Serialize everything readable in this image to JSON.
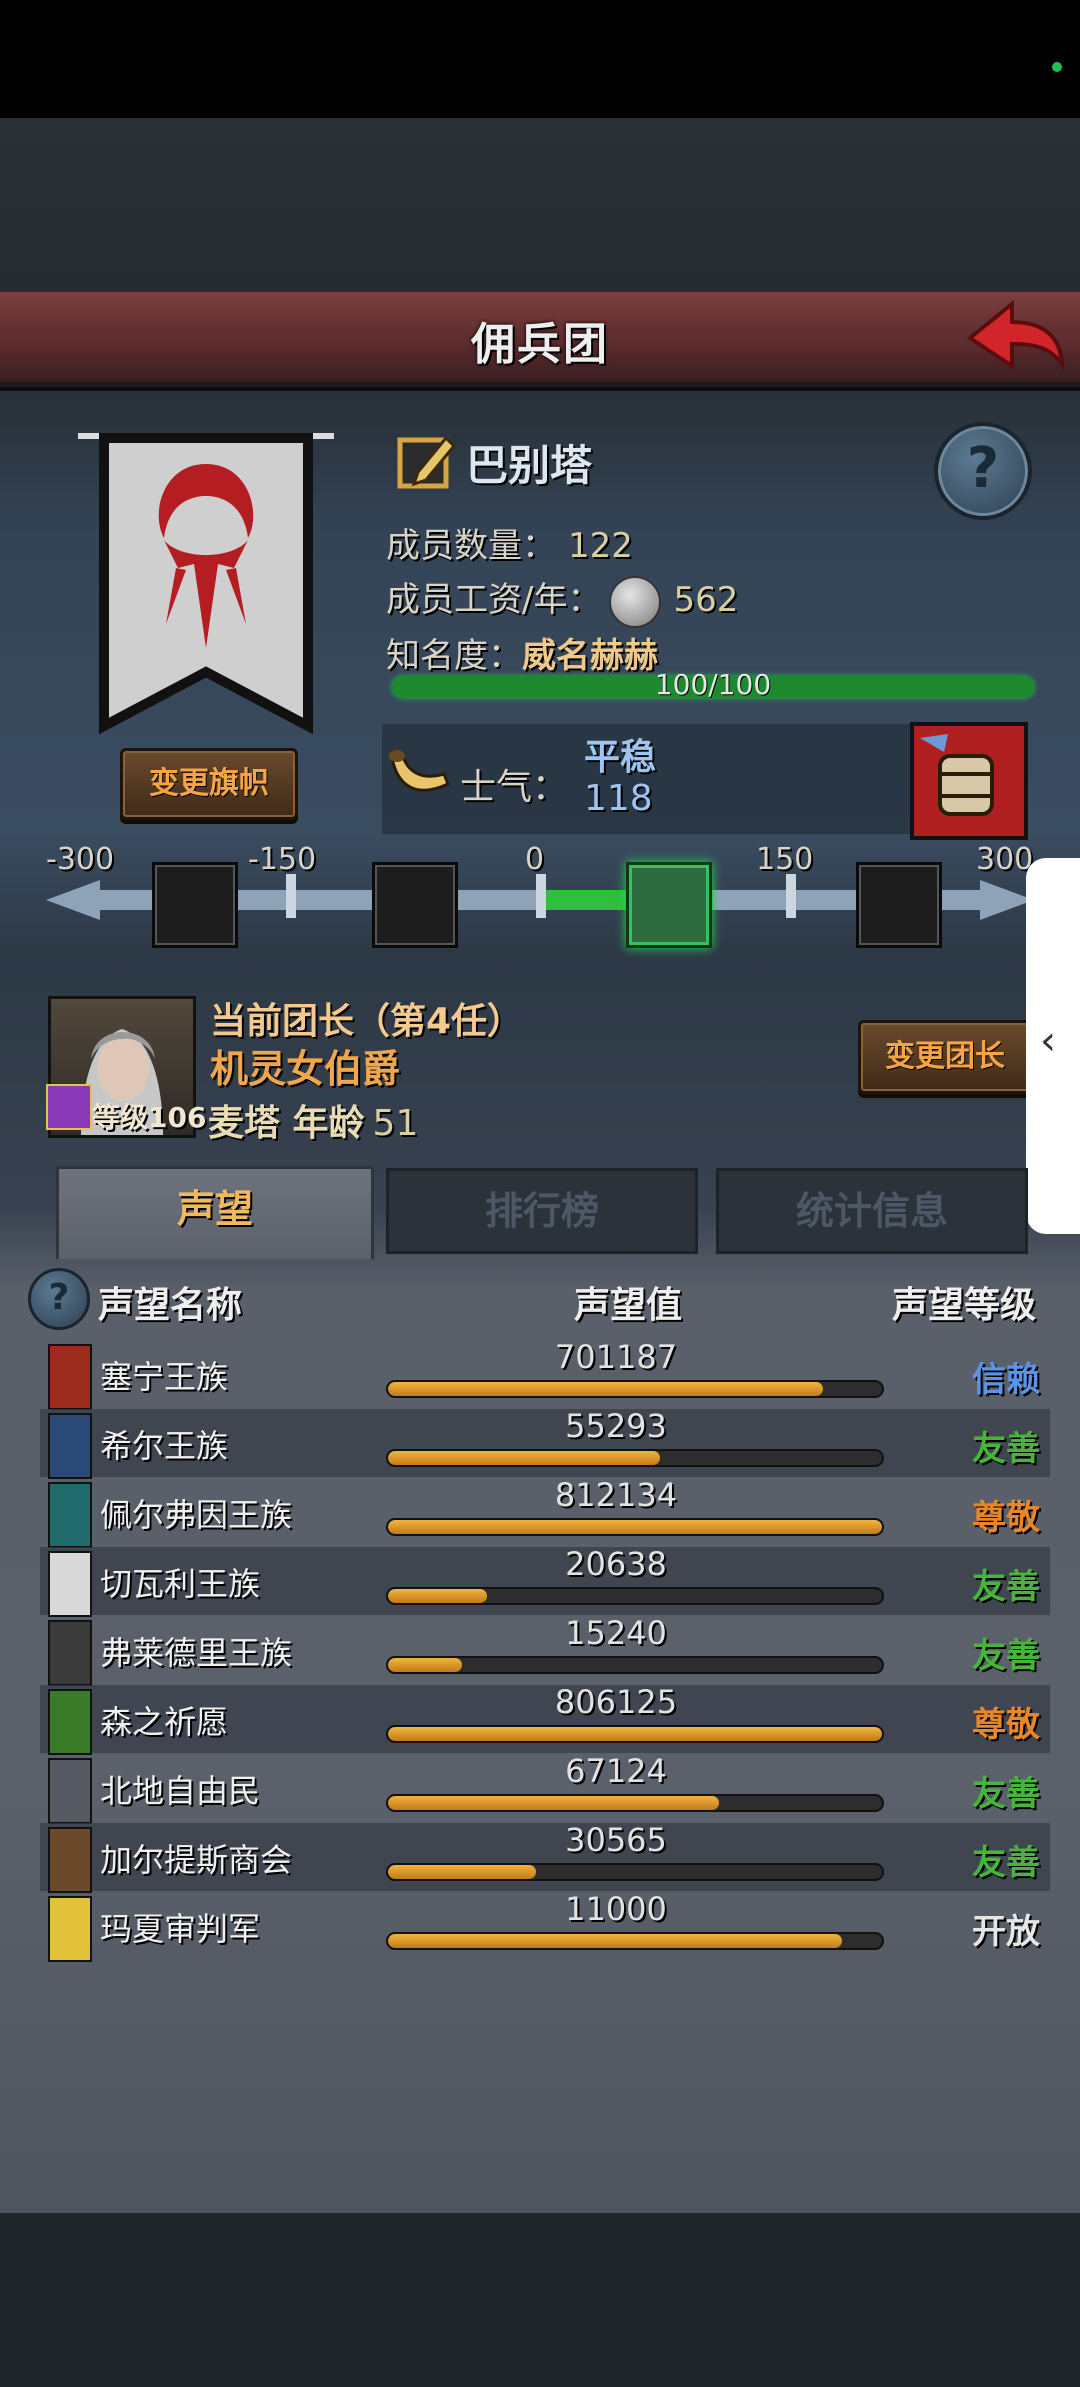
{
  "title": "佣兵团",
  "company": {
    "name": "巴别塔",
    "members_label": "成员数量：",
    "members": "122",
    "wage_label": "成员工资/年：",
    "wage": "562",
    "fame_label": "知名度：",
    "fame": "威名赫赫",
    "fame_progress": "100/100",
    "fame_fraction": 1.0
  },
  "buttons": {
    "change_flag": "变更旗帜",
    "change_leader": "变更团长"
  },
  "morale": {
    "label": "士气：",
    "state": "平稳",
    "value": "118",
    "ticks": [
      "-300",
      "-150",
      "0",
      "150",
      "300"
    ],
    "current": 118,
    "range": [
      -300,
      300
    ]
  },
  "leader": {
    "title": "当前团长（第4任）",
    "name": "机灵女伯爵",
    "level_label": "等级106",
    "race_age": "麦塔  年龄",
    "age": "51"
  },
  "tabs": [
    {
      "label": "声望",
      "active": true
    },
    {
      "label": "排行榜",
      "active": false
    },
    {
      "label": "统计信息",
      "active": false
    }
  ],
  "table": {
    "headers": {
      "name": "声望名称",
      "value": "声望值",
      "level": "声望等级"
    },
    "rows": [
      {
        "name": "塞宁王族",
        "value": "701187",
        "fill": 0.88,
        "level": "信赖",
        "level_color": "#5b93e8",
        "crest_color": "#9c2a1d"
      },
      {
        "name": "希尔王族",
        "value": "55293",
        "fill": 0.55,
        "level": "友善",
        "level_color": "#47b43a",
        "crest_color": "#2c4a78"
      },
      {
        "name": "佩尔弗因王族",
        "value": "812134",
        "fill": 1.0,
        "level": "尊敬",
        "level_color": "#e8862a",
        "crest_color": "#1f6b6b"
      },
      {
        "name": "切瓦利王族",
        "value": "20638",
        "fill": 0.2,
        "level": "友善",
        "level_color": "#47b43a",
        "crest_color": "#d9d9d9"
      },
      {
        "name": "弗莱德里王族",
        "value": "15240",
        "fill": 0.15,
        "level": "友善",
        "level_color": "#47b43a",
        "crest_color": "#3b3b3b"
      },
      {
        "name": "森之祈愿",
        "value": "806125",
        "fill": 1.0,
        "level": "尊敬",
        "level_color": "#e8862a",
        "crest_color": "#3a7b2a"
      },
      {
        "name": "北地自由民",
        "value": "67124",
        "fill": 0.67,
        "level": "友善",
        "level_color": "#47b43a",
        "crest_color": "#555a62"
      },
      {
        "name": "加尔提斯商会",
        "value": "30565",
        "fill": 0.3,
        "level": "友善",
        "level_color": "#47b43a",
        "crest_color": "#6b4a2b"
      },
      {
        "name": "玛夏审判军",
        "value": "11000",
        "fill": 0.92,
        "level": "开放",
        "level_color": "#e6e6e6",
        "crest_color": "#e2c23a"
      }
    ]
  }
}
